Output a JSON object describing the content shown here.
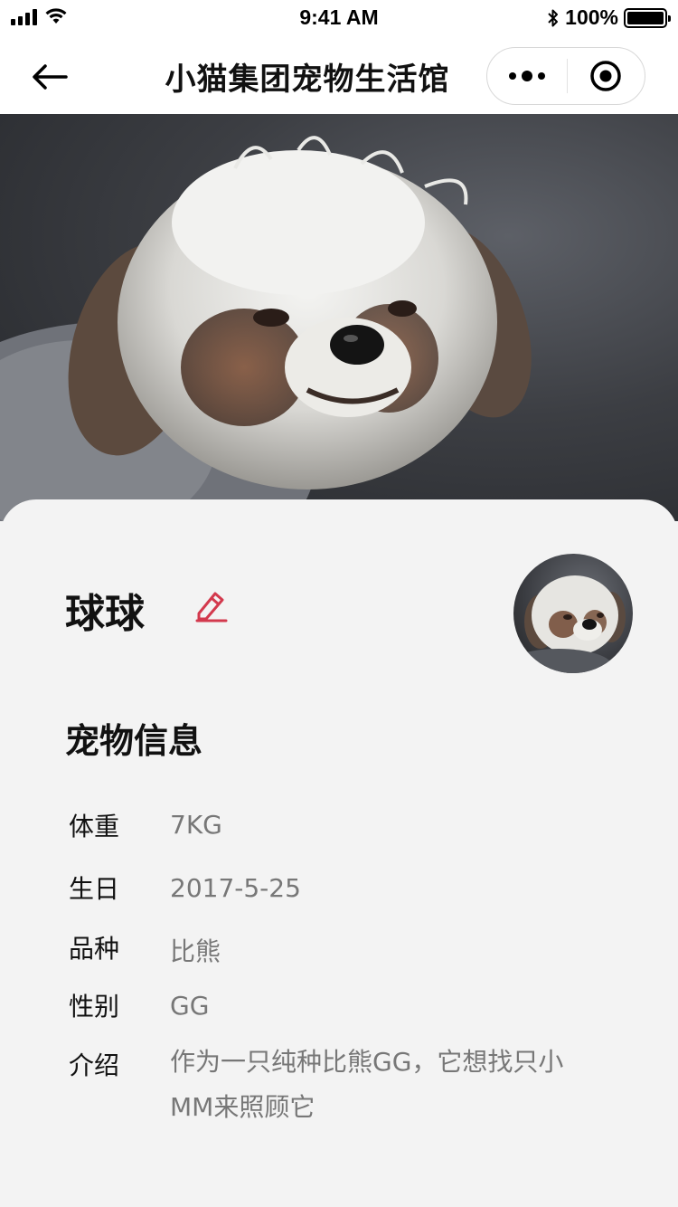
{
  "status_bar": {
    "time": "9:41 AM",
    "battery_text": "100%",
    "battery_level_percent": 100
  },
  "nav": {
    "title": "小猫集团宠物生活馆"
  },
  "pet": {
    "name": "球球"
  },
  "info": {
    "section_title": "宠物信息",
    "rows": [
      {
        "label": "体重",
        "value": "7KG"
      },
      {
        "label": "生日",
        "value": "2017-5-25"
      },
      {
        "label": "品种",
        "value": "比熊"
      },
      {
        "label": "性别",
        "value": "GG"
      },
      {
        "label": "介绍",
        "value": "作为一只纯种比熊GG，它想找只小MM来照顾它"
      }
    ]
  },
  "icons": {
    "back": "arrow-left-icon",
    "more": "more-dots-icon",
    "close": "target-circle-icon",
    "edit": "pencil-icon"
  },
  "colors": {
    "accent_edit": "#d3394d",
    "value_text": "#777777",
    "card_bg": "#f3f3f3"
  }
}
